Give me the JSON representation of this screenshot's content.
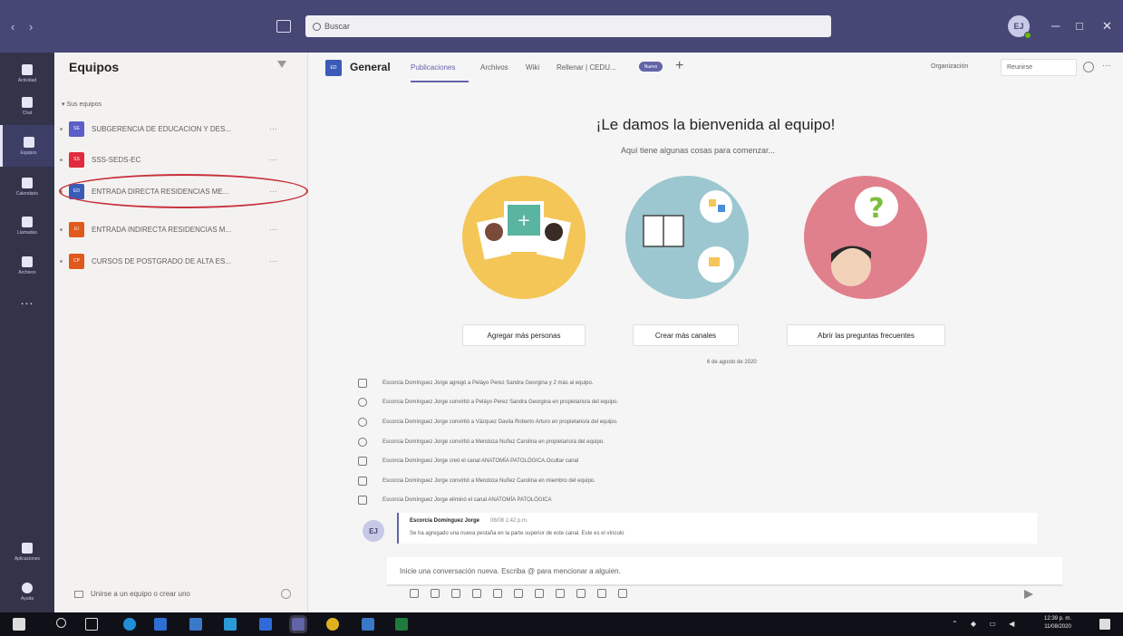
{
  "search": {
    "placeholder": "Buscar"
  },
  "user": {
    "initials": "EJ"
  },
  "rail": {
    "items": [
      {
        "label": "Actividad",
        "icon": "bell-icon"
      },
      {
        "label": "Chat",
        "icon": "chat-icon"
      },
      {
        "label": "Equipos",
        "icon": "teams-icon"
      },
      {
        "label": "Calendario",
        "icon": "calendar-icon"
      },
      {
        "label": "Llamadas",
        "icon": "phone-icon"
      },
      {
        "label": "Archivos",
        "icon": "file-icon"
      }
    ],
    "more": "...",
    "apps_label": "Aplicaciones",
    "help_label": "Ayuda"
  },
  "teams_pane": {
    "title": "Equipos",
    "section_label": "▾ Sus equipos",
    "teams": [
      {
        "name": "SUBGERENCIA DE EDUCACION Y DES...",
        "color": "#5b5fc7",
        "initials": "SE"
      },
      {
        "name": "SSS-SEDS-EC",
        "color": "#e02c3c",
        "initials": "SS"
      },
      {
        "name": "ENTRADA DIRECTA RESIDENCIAS ME...",
        "color": "#3a5bb8",
        "initials": "ED"
      },
      {
        "name": "ENTRADA INDIRECTA RESIDENCIAS M...",
        "color": "#e05a1e",
        "initials": "EI"
      },
      {
        "name": "CURSOS DE POSTGRADO DE ALTA ES...",
        "color": "#e05a1e",
        "initials": "CP"
      }
    ],
    "more_label": "···",
    "join_label": "Unirse a un equipo o crear uno"
  },
  "channel": {
    "badge": "ED",
    "name": "General",
    "tabs": [
      "Publicaciones",
      "Archivos",
      "Wiki",
      "Rellenar | CEDU..."
    ],
    "new_badge": "Nuevo",
    "add_tab": "+",
    "org_label": "Organización",
    "meet_label": "Reunirse",
    "more": "···"
  },
  "welcome": {
    "title": "¡Le damos la bienvenida al equipo!",
    "subtitle": "Aquí tiene algunas cosas para comenzar...",
    "buttons": [
      "Agregar más personas",
      "Crear más canales",
      "Abrir las preguntas frecuentes"
    ]
  },
  "activity": {
    "date": "6 de agosto de 2020",
    "items": [
      "Escorcia Domínguez Jorge agregó a Peláyo Perez Sandra Georgina y 2 más al equipo.",
      "Escorcia Domínguez Jorge convirtió a Peláyo Perez Sandra Georgina en propietario/a del equipo.",
      "Escorcia Domínguez Jorge convirtió a Vázquez Davila Roberto Arturo en propietario/a del equipo.",
      "Escorcia Domínguez Jorge convirtió a Mendoza Nuñez Carolina en propietario/a del equipo.",
      "Escorcia Domínguez Jorge creó el canal ANATOMÍA PATOLÓGICA.Ocultar canal",
      "Escorcia Domínguez Jorge convirtió a Mendoza Nuñez Carolina en miembro del equipo.",
      "Escorcia Domínguez Jorge eliminó el canal ANATOMÍA PATOLÓGICA"
    ]
  },
  "message": {
    "author": "Escorcia Domínguez Jorge",
    "time": "06/08 1:42 p.m.",
    "body": "Se ha agregado una nueva pestaña en la parte superior de este canal. Este es el vínculo"
  },
  "compose": {
    "placeholder": "Inicie una conversación nueva. Escriba @ para mencionar a alguien."
  },
  "taskbar": {
    "time": "12:39 p. m.",
    "date": "11/08/2020"
  },
  "colors": {
    "titlebar": "#464775",
    "rail": "#33344a",
    "accent": "#6264a7",
    "highlight": "#c8323c"
  }
}
